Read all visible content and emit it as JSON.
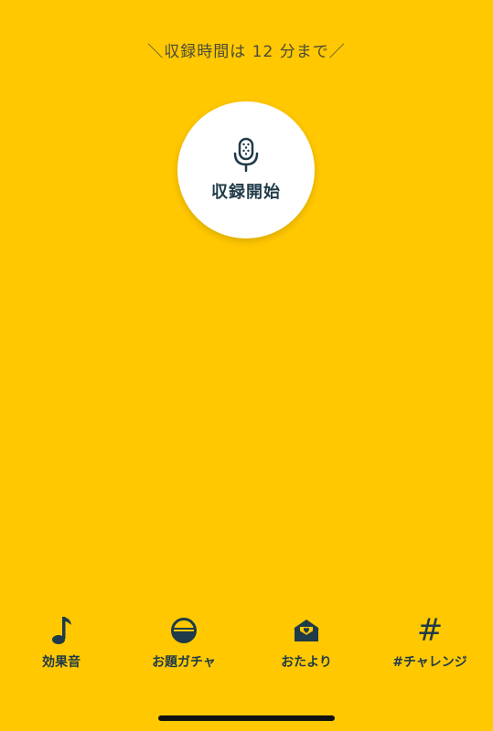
{
  "recording": {
    "time_limit_text": "＼収録時間は 12 分まで／",
    "start_label": "収録開始",
    "start_icon": "microphone-icon"
  },
  "nav": {
    "items": [
      {
        "label": "効果音",
        "icon": "music-note-icon"
      },
      {
        "label": "お題ガチャ",
        "icon": "gacha-capsule-icon"
      },
      {
        "label": "おたより",
        "icon": "letter-heart-icon"
      },
      {
        "label": "#チャレンジ",
        "icon": "hash-icon",
        "glyph": "#"
      }
    ]
  },
  "colors": {
    "background": "#FFC800",
    "accent_dark": "#1F3A48",
    "button_bg": "#FFFFFF"
  }
}
